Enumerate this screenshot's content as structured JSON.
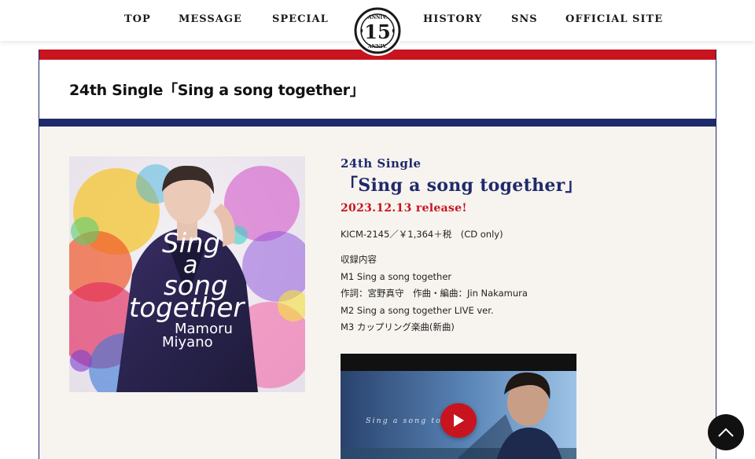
{
  "nav": {
    "left": [
      "TOP",
      "MESSAGE",
      "SPECIAL"
    ],
    "right": [
      "HISTORY",
      "SNS",
      "OFFICIAL SITE"
    ],
    "logo_number": "15",
    "logo_text_top": "ANNIV.",
    "logo_text_bottom": "ANNIV."
  },
  "page": {
    "title": "24th Single「Sing a song together」"
  },
  "release": {
    "single_no": "24th Single",
    "title": "「Sing a song together」",
    "date": "2023.12.13 release!",
    "catalog": "KICM-2145／￥1,364＋税　(CD only)",
    "tracklist_heading": "収録内容",
    "tracks": [
      "M1 Sing a song together",
      "作詞：宮野真守　作曲・編曲：Jin Nakamura",
      "M2 Sing a song together LIVE ver.",
      "M3 カップリング楽曲(新曲)"
    ]
  },
  "jacket": {
    "line1": "Sing",
    "line2": "a",
    "line3": "song",
    "line4": "together",
    "artist1": "Mamoru",
    "artist2": "Miyano"
  },
  "video": {
    "caption": "Sing a song toge"
  },
  "colors": {
    "red": "#c8141f",
    "navy": "#1f2a6b",
    "card_bg": "#f7f4ef"
  },
  "icons": {
    "play": "play-icon",
    "back_to_top": "chevron-up-icon"
  }
}
